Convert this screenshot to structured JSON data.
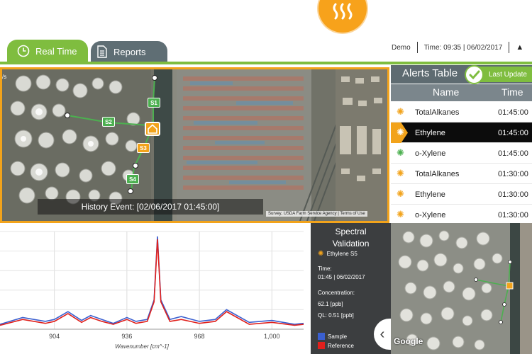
{
  "header": {
    "user": "Demo",
    "time": "Time: 09:35 | 06/02/2017"
  },
  "tabs": [
    {
      "label": "Real Time",
      "active": true
    },
    {
      "label": "Reports",
      "active": false
    }
  ],
  "map": {
    "history_event": "History Event: [02/06/2017 01:45:00]",
    "attribution": "Survey, USDA Farm Service Agency | Terms of Use",
    "corner_text": "/s",
    "labels": [
      "S1",
      "S2",
      "S3",
      "S4"
    ]
  },
  "alerts": {
    "title": "Alerts Table",
    "last_update": "Last Update",
    "columns": {
      "name": "Name",
      "time": "Time"
    },
    "rows": [
      {
        "name": "TotalAlkanes",
        "time": "01:45:00",
        "status": "orange",
        "selected": false
      },
      {
        "name": "Ethylene",
        "time": "01:45:00",
        "status": "orange",
        "selected": true
      },
      {
        "name": "o-Xylene",
        "time": "01:45:00",
        "status": "green",
        "selected": false
      },
      {
        "name": "TotalAlkanes",
        "time": "01:30:00",
        "status": "orange",
        "selected": false
      },
      {
        "name": "Ethylene",
        "time": "01:30:00",
        "status": "orange",
        "selected": false
      },
      {
        "name": "o-Xylene",
        "time": "01:30:00",
        "status": "orange",
        "selected": false
      }
    ]
  },
  "validation": {
    "title_line1": "Spectral",
    "title_line2": "Validation",
    "compound": "Ethylene S5",
    "time_label": "Time:",
    "time_value": "01:45 | 06/02/2017",
    "concentration_label": "Concentration:",
    "concentration_value": "62.1 [ppb]",
    "ql": "QL: 0.51 [ppb]",
    "legend_sample": "Sample",
    "legend_reference": "Reference",
    "colors": {
      "sample": "#3a5fd0",
      "reference": "#e0201c"
    }
  },
  "mini_map": {
    "google": "Google"
  },
  "chart_data": {
    "type": "line",
    "xlabel": "Wavenumber [cm^-1]",
    "xlim": [
      880,
      1014
    ],
    "ylim": [
      0,
      1
    ],
    "x_ticks": [
      904,
      936,
      968,
      "1,000"
    ],
    "grid": true,
    "series": [
      {
        "name": "Sample",
        "color": "#3a5fd0",
        "x": [
          880,
          890,
          900,
          904,
          910,
          916,
          920,
          925,
          930,
          936,
          940,
          945,
          948,
          949.5,
          951,
          955,
          960,
          968,
          975,
          980,
          990,
          1000,
          1010,
          1014
        ],
        "y": [
          0.05,
          0.12,
          0.08,
          0.1,
          0.18,
          0.09,
          0.14,
          0.1,
          0.06,
          0.12,
          0.08,
          0.1,
          0.3,
          0.95,
          0.3,
          0.1,
          0.13,
          0.08,
          0.1,
          0.2,
          0.07,
          0.09,
          0.05,
          0.06
        ]
      },
      {
        "name": "Reference",
        "color": "#e0201c",
        "x": [
          880,
          890,
          900,
          904,
          910,
          916,
          920,
          925,
          930,
          936,
          940,
          945,
          948,
          949.5,
          951,
          955,
          960,
          968,
          975,
          980,
          990,
          1000,
          1010,
          1014
        ],
        "y": [
          0.04,
          0.1,
          0.06,
          0.08,
          0.16,
          0.07,
          0.12,
          0.08,
          0.05,
          0.1,
          0.06,
          0.08,
          0.28,
          0.92,
          0.28,
          0.08,
          0.1,
          0.06,
          0.08,
          0.18,
          0.05,
          0.07,
          0.04,
          0.05
        ]
      }
    ]
  }
}
